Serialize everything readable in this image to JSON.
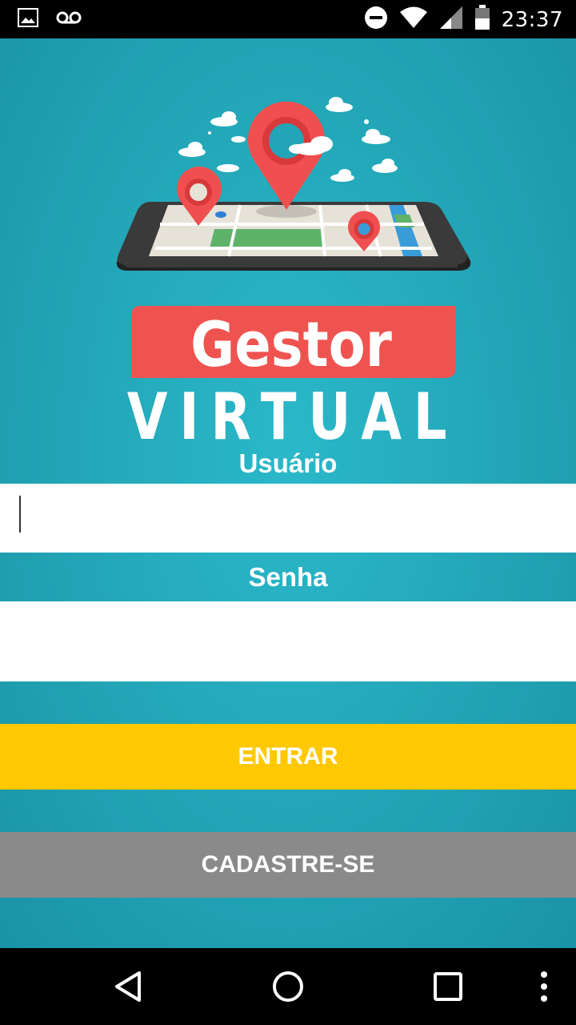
{
  "status_bar": {
    "time": "23:37",
    "icons_left": [
      "image-icon",
      "voicemail-icon"
    ],
    "icons_right": [
      "do-not-disturb-icon",
      "wifi-icon",
      "signal-icon",
      "battery-icon"
    ]
  },
  "branding": {
    "logo_word_1": "Gestor",
    "logo_word_2": "VIRTUAL",
    "accent_red": "#ef5350",
    "accent_teal": "#22a5b6"
  },
  "form": {
    "username_label": "Usuário",
    "username_value": "",
    "password_label": "Senha",
    "password_value": ""
  },
  "actions": {
    "login_label": "ENTRAR",
    "register_label": "CADASTRE-SE",
    "login_color": "#ffc800",
    "register_color": "#8a8a8a"
  },
  "nav_bar": {
    "icons": [
      "back-icon",
      "home-icon",
      "recents-icon",
      "overflow-menu-icon"
    ]
  }
}
